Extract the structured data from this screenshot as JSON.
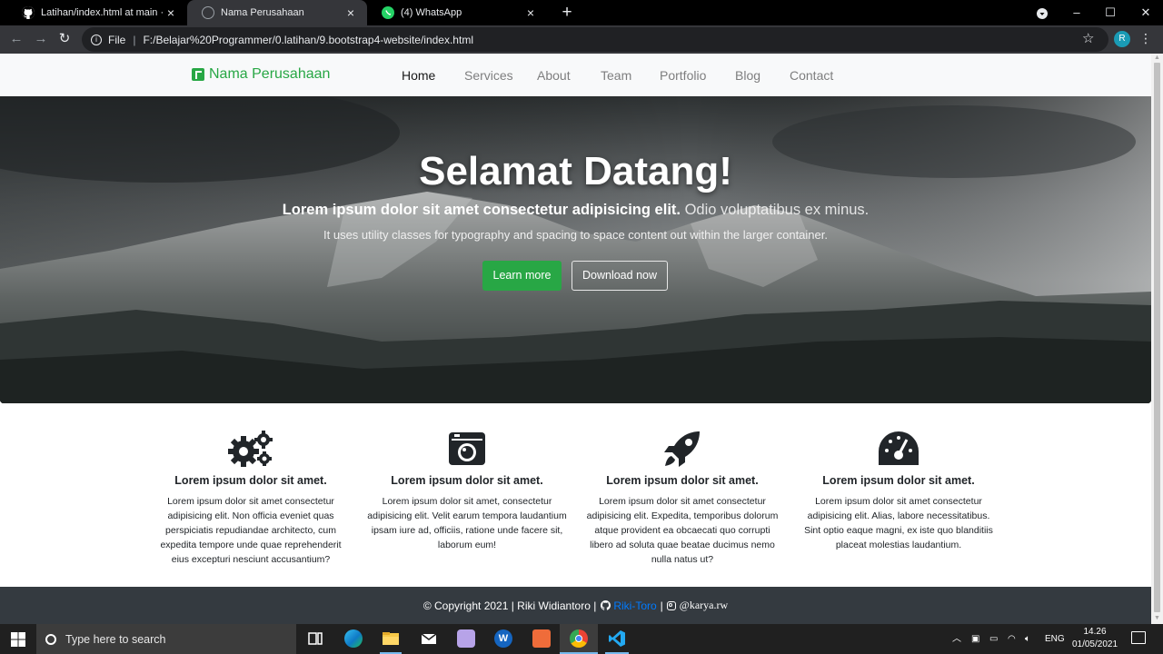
{
  "browser": {
    "tabs": [
      {
        "title": "Latihan/index.html at main · Riki·",
        "icon": "github-icon"
      },
      {
        "title": "Nama Perusahaan",
        "icon": "globe-icon"
      },
      {
        "title": "(4) WhatsApp",
        "icon": "whatsapp-icon"
      }
    ],
    "url_scheme": "File",
    "url": "F:/Belajar%20Programmer/0.latihan/9.bootstrap4-website/index.html",
    "profile_initial": "R"
  },
  "site": {
    "brand": "Nama Perusahaan",
    "nav": [
      "Home",
      "Services",
      "About",
      "Team",
      "Portfolio",
      "Blog",
      "Contact"
    ],
    "hero": {
      "title": "Selamat Datang!",
      "lead_bold": "Lorem ipsum dolor sit amet consectetur adipisicing elit.",
      "lead_light": "Odio voluptatibus ex minus.",
      "sub": "It uses utility classes for typography and spacing to space content out within the larger container.",
      "btn_primary": "Learn more",
      "btn_secondary": "Download now"
    },
    "features": [
      {
        "icon": "gears-icon",
        "title": "Lorem ipsum dolor sit amet.",
        "text": "Lorem ipsum dolor sit amet consectetur adipisicing elit. Non officia eveniet quas perspiciatis repudiandae architecto, cum expedita tempore unde quae reprehenderit eius excepturi nesciunt accusantium?"
      },
      {
        "icon": "camera-icon",
        "title": "Lorem ipsum dolor sit amet.",
        "text": "Lorem ipsum dolor sit amet, consectetur adipisicing elit. Velit earum tempora laudantium ipsam iure ad, officiis, ratione unde facere sit, laborum eum!"
      },
      {
        "icon": "rocket-icon",
        "title": "Lorem ipsum dolor sit amet.",
        "text": "Lorem ipsum dolor sit amet consectetur adipisicing elit. Expedita, temporibus dolorum atque provident ea obcaecati quo corrupti libero ad soluta quae beatae ducimus nemo nulla natus ut?"
      },
      {
        "icon": "tachometer-icon",
        "title": "Lorem ipsum dolor sit amet.",
        "text": "Lorem ipsum dolor sit amet consectetur adipisicing elit. Alias, labore necessitatibus. Sint optio eaque magni, ex iste quo blanditiis placeat molestias laudantium."
      }
    ],
    "footer": {
      "copyright": "© Copyright 2021 | Riki Widiantoro |",
      "github_user": "Riki-Toro",
      "sep": "|",
      "instagram": "@karya.rw"
    },
    "colors": {
      "primary": "#28a745",
      "dark": "#343a40",
      "link": "#007bff"
    }
  },
  "taskbar": {
    "search_placeholder": "Type here to search",
    "language": "ENG",
    "time": "14.26",
    "date": "01/05/2021"
  }
}
